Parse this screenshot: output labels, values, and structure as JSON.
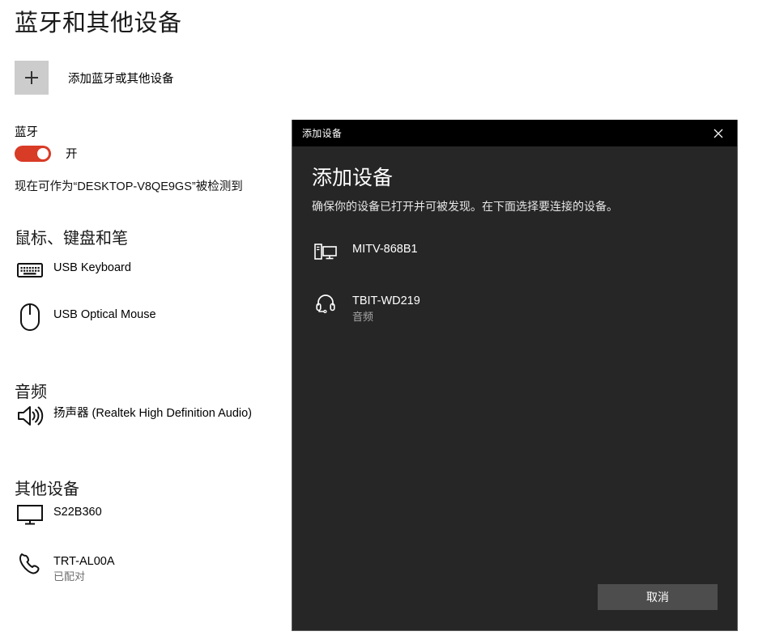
{
  "settings": {
    "page_title": "蓝牙和其他设备",
    "add_device": {
      "icon": "plus-icon",
      "label": "添加蓝牙或其他设备"
    },
    "bluetooth": {
      "label": "蓝牙",
      "toggle_state": "开",
      "toggle_on": true,
      "accent_color": "#d83b26",
      "discoverable_text": "现在可作为“DESKTOP-V8QE9GS”被检测到"
    },
    "sections": [
      {
        "id": "mouse-keyboard-pen",
        "title": "鼠标、键盘和笔",
        "devices": [
          {
            "icon": "keyboard-icon",
            "name": "USB Keyboard",
            "status": ""
          },
          {
            "icon": "mouse-icon",
            "name": "USB Optical Mouse",
            "status": ""
          }
        ]
      },
      {
        "id": "audio",
        "title": "音频",
        "devices": [
          {
            "icon": "speaker-icon",
            "name": "扬声器 (Realtek High Definition Audio)",
            "status": ""
          }
        ]
      },
      {
        "id": "other-devices",
        "title": "其他设备",
        "devices": [
          {
            "icon": "monitor-icon",
            "name": "S22B360",
            "status": ""
          },
          {
            "icon": "phone-icon",
            "name": "TRT-AL00A",
            "status": "已配对"
          }
        ]
      }
    ]
  },
  "dialog": {
    "titlebar_label": "添加设备",
    "close_icon": "close-icon",
    "heading": "添加设备",
    "subheading": "确保你的设备已打开并可被发现。在下面选择要连接的设备。",
    "devices": [
      {
        "icon": "desktop-pc-icon",
        "name": "MITV-868B1",
        "sub": ""
      },
      {
        "icon": "headset-icon",
        "name": "TBIT-WD219",
        "sub": "音频"
      }
    ],
    "cancel_label": "取消",
    "background_color": "#262626",
    "titlebar_color": "#000000",
    "button_color": "#4d4d4d"
  }
}
